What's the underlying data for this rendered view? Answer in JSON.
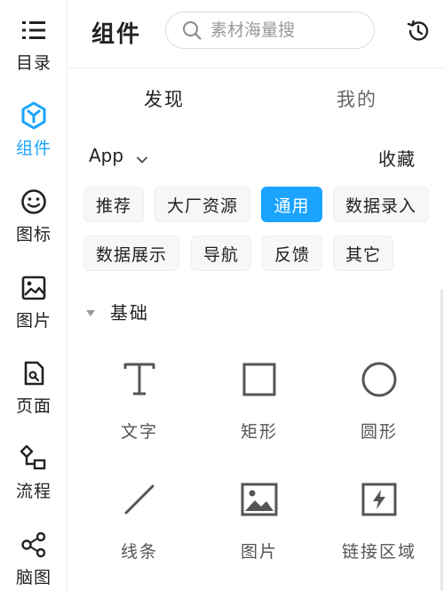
{
  "sidebar": {
    "items": [
      {
        "label": "目录",
        "icon": "menu-list-icon"
      },
      {
        "label": "组件",
        "icon": "component-hexagon-icon",
        "active": true
      },
      {
        "label": "图标",
        "icon": "smiley-icon"
      },
      {
        "label": "图片",
        "icon": "image-icon"
      },
      {
        "label": "页面",
        "icon": "page-icon"
      },
      {
        "label": "流程",
        "icon": "flow-icon"
      },
      {
        "label": "脑图",
        "icon": "mindmap-icon"
      }
    ]
  },
  "header": {
    "title": "组件",
    "search_placeholder": "素材海量搜",
    "history_icon": "history-icon"
  },
  "tabs": [
    {
      "label": "发现",
      "active": true
    },
    {
      "label": "我的",
      "active": false
    }
  ],
  "filter": {
    "app_label": "App",
    "favorites_label": "收藏"
  },
  "chips": [
    {
      "label": "推荐",
      "active": false
    },
    {
      "label": "大厂资源",
      "active": false
    },
    {
      "label": "通用",
      "active": true
    },
    {
      "label": "数据录入",
      "active": false
    },
    {
      "label": "数据展示",
      "active": false
    },
    {
      "label": "导航",
      "active": false
    },
    {
      "label": "反馈",
      "active": false
    },
    {
      "label": "其它",
      "active": false
    }
  ],
  "section": {
    "title": "基础",
    "items": [
      {
        "label": "文字",
        "icon": "text-icon"
      },
      {
        "label": "矩形",
        "icon": "rectangle-icon"
      },
      {
        "label": "圆形",
        "icon": "circle-icon"
      },
      {
        "label": "线条",
        "icon": "line-icon"
      },
      {
        "label": "图片",
        "icon": "image-icon"
      },
      {
        "label": "链接区域",
        "icon": "link-area-icon"
      }
    ]
  },
  "colors": {
    "accent": "#1aa3ff",
    "icon_gray": "#5a5a5a"
  }
}
